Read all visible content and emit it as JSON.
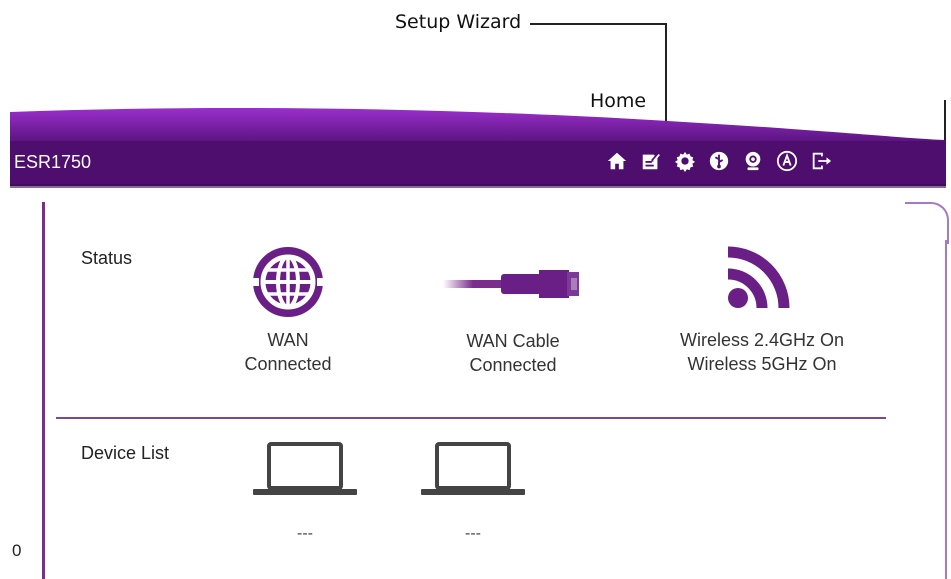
{
  "callouts": {
    "setup_wizard": "Setup Wizard",
    "home": "Home"
  },
  "header": {
    "model": "ESR1750",
    "nav_icons": [
      "home-icon",
      "setup-wizard-icon",
      "settings-gear-icon",
      "usb-icon",
      "webcam-icon",
      "firmware-a-icon",
      "logout-icon"
    ],
    "colors": {
      "bar": "#4e0e6d",
      "wave_top": "#8a22b8",
      "wave_bottom": "#5d1680",
      "accent": "#7b2d8e"
    }
  },
  "sidebar": {
    "fragment": "0"
  },
  "status": {
    "label": "Status",
    "items": [
      {
        "icon": "globe-icon",
        "line1": "WAN",
        "line2": "Connected"
      },
      {
        "icon": "ethernet-cable-icon",
        "line1": "WAN Cable",
        "line2": "Connected"
      },
      {
        "icon": "wifi-signal-icon",
        "line1": "Wireless 2.4GHz On",
        "line2": "Wireless 5GHz On"
      }
    ]
  },
  "device_list": {
    "label": "Device List",
    "devices": [
      {
        "icon": "laptop-icon",
        "name": "---"
      },
      {
        "icon": "laptop-icon",
        "name": "---"
      }
    ]
  }
}
